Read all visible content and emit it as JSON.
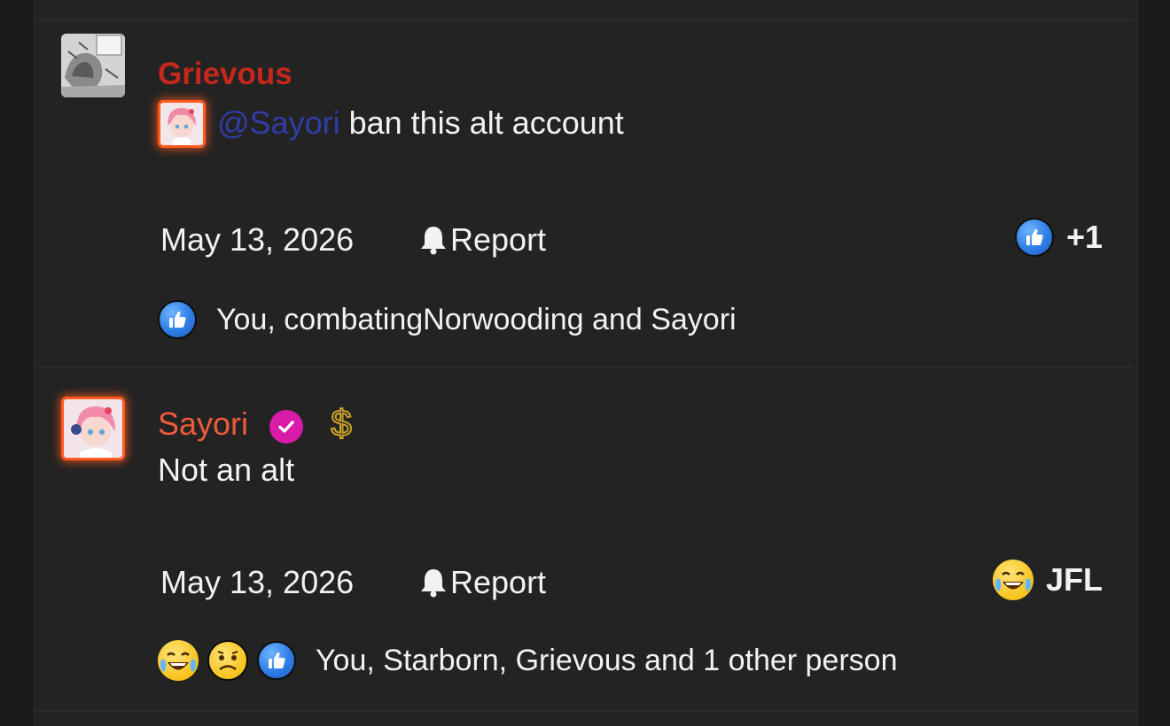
{
  "posts": [
    {
      "author": "Grievous",
      "mention": "@Sayori",
      "text": " ban this alt account",
      "date": "May 13, 2026",
      "report_label": "Report",
      "reaction_summary": "+1",
      "reaction_summary_icon": "like-icon",
      "likers": "You, combatingNorwooding and Sayori",
      "liker_icons": [
        "like-icon"
      ]
    },
    {
      "author": "Sayori",
      "author_badges": [
        "verified-check-icon",
        "dollar-icon"
      ],
      "text": "Not an alt",
      "date": "May 13, 2026",
      "report_label": "Report",
      "reaction_summary": "JFL",
      "reaction_summary_icon": "crying-laughing-icon",
      "likers": "You, Starborn, Grievous and 1 other person",
      "liker_icons": [
        "crying-laughing-icon",
        "sad-face-icon",
        "like-icon"
      ]
    }
  ],
  "colors": {
    "background": "#232323",
    "grievous_name": "#c4281c",
    "sayori_name": "#f05a3a",
    "mention": "#2f3ea6",
    "like_blue": "#2e7ee6",
    "verified": "#d81ba8",
    "avatar_glow": "#ff5a1f"
  }
}
